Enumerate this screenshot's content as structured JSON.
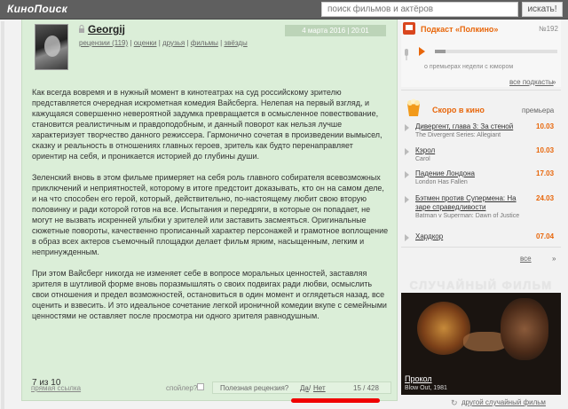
{
  "header": {
    "logo": "КиноПоиск",
    "search_placeholder": "поиск фильмов и актёров",
    "search_button": "искать!"
  },
  "review": {
    "username": "Georgij",
    "links": [
      "рецензии (119)",
      "оценки",
      "друзья",
      "фильмы",
      "звёзды"
    ],
    "date": "4 марта 2016 | 20:01",
    "paragraphs": [
      "Как всегда вовремя и в нужный момент в кинотеатрах на суд российскому зрителю представляется очередная искрометная комедия Вайсберга. Нелепая на первый взгляд, и кажущаяся совершенно невероятной задумка превращается в осмысленное повествование, становится реалистичным и правдоподобным, и данный поворот как нельзя лучше характеризует творчество данного режиссера. Гармонично сочетая в произведении вымысел, сказку и реальность в отношениях главных героев, зритель как будто перенаправляет ориентир на себя, и проникается историей до глубины души.",
      "Зеленский вновь в этом фильме примеряет на себя роль главного собирателя всевозможных приключений и неприятностей, которому в итоге предстоит доказывать, кто он на самом деле, и на что способен его герой, который, действительно, по-настоящему любит свою вторую половинку и ради которой готов на все. Испытания и передряги, в которые он попадает, не могут не вызвать искренней улыбки у зрителей или заставить засмеяться. Оригинальные сюжетные повороты, качественно прописанный характер персонажей и грамотное воплощение в образ всех актеров съемочный площадки делает фильм ярким, насыщенным, легким и непринужденным.",
      "При этом Вайсберг никогда не изменяет себе в вопросе моральных ценностей, заставляя зрителя в шутливой форме вновь поразмышлять о своих подвигах ради любви, осмыслить свои отношения и предел возможностей, остановиться в один момент и оглядеться назад, все оценить и взвесить. И это идеальное сочетание легкой ироничной комедии вкупе с семейными ценностями не оставляет после просмотра ни одного зрителя равнодушным."
    ],
    "rating": "7 из 10",
    "permalink": "прямая ссылка",
    "spoiler": "спойлер?",
    "useful_label": "Полезная рецензия?",
    "yes": "Да",
    "slash": "/",
    "no": "Нет",
    "counter": "15 / 428"
  },
  "podcast": {
    "title": "Подкаст «Полкино»",
    "number": "№192",
    "description": "о премьерах недели с юмором",
    "all_link": "все подкасты",
    "progress": 0.09,
    "accent_color": "#e8660a"
  },
  "soon": {
    "title": "Скоро в кино",
    "premiere_label": "премьера",
    "movies": [
      {
        "title": "Дивергент, глава 3: За стеной",
        "original": "The Divergent Series: Allegiant",
        "date": "10.03"
      },
      {
        "title": "Кэрол",
        "original": "Carol",
        "date": "10.03"
      },
      {
        "title": "Падение Лондона",
        "original": "London Has Fallen",
        "date": "17.03"
      },
      {
        "title": "Бэтмен против Супермена: На заре справедливости",
        "original": "Batman v Superman: Dawn of Justice",
        "date": "24.03"
      },
      {
        "title": "Хардкор",
        "original": "",
        "date": "07.04"
      }
    ],
    "all_link": "все"
  },
  "random_film": {
    "header": "СЛУЧАЙНЫЙ ФИЛЬМ",
    "title": "Прокол",
    "subtitle": "Blow Out, 1981",
    "other_link": "другой случайный фильм"
  }
}
